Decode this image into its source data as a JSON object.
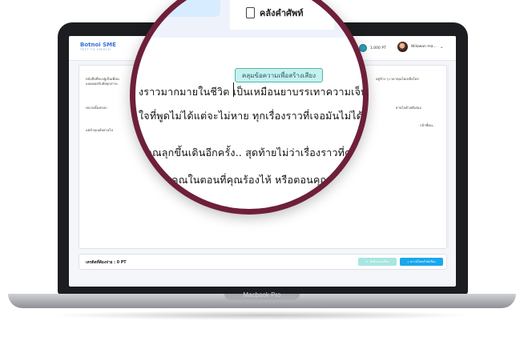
{
  "app": {
    "brand": "Botnoi SME",
    "brand_sub": "TEXT TO SPEECH",
    "points": "1,000 PT",
    "user_name": "Wilawan ma..."
  },
  "content": {
    "paragraphs": [
      "หนังสือที่จะอยู่เป็นเพื่อน",
      "แลดคอยรับฟังทุกสาระ",
      "ขนาดนั้นหรอก",
      "แต่ถ้าคุณยังผ่านไป"
    ],
    "para_right": [
      "อยู่ข้าง ๆ เวลาคุณไม่เหลือใคร",
      "ผ่านไปด้วยดีเสมอ",
      "กล้าที่คน.."
    ]
  },
  "footer": {
    "cost_label": "เครดิตที่ต้องจ่าย : 0 PT",
    "preview_button": "ฟังตัวอย่างเสียง",
    "download_button": "ดาวน์โหลดไฟล์เสียง"
  },
  "magnifier": {
    "tab_label": "คลังคำศัพท์",
    "tooltip": "คลุมข้อความเพื่อสร้างเสียง",
    "lines": [
      "งราวมากมายในชีวิต เป็นเหมือนยาบรรเทาความเจ็บป",
      "ใจที่พูดไม่ได้แต่จะไม่หาย  ทุกเรื่องราวที่เจอมันไม่ได้แย่",
      "ห้คุณลุกขึ้นเดินอีกครั้ง.. สุดท้ายไม่ว่าเรื่องราวที่คุณเจอจ",
      "อยู่กับคุณในตอนที่คุณร้องไห้    หรือตอนคุณหัวเราะ"
    ]
  },
  "device": {
    "label": "Macbook Pro"
  }
}
